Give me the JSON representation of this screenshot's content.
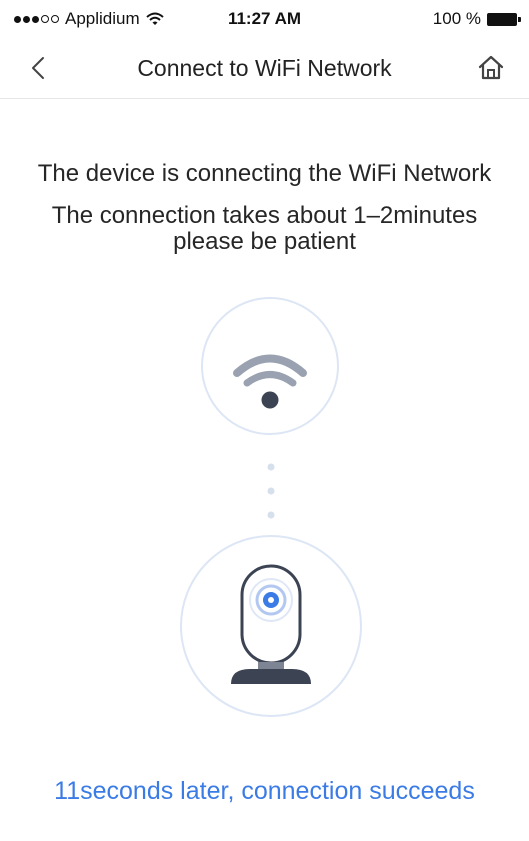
{
  "status_bar": {
    "carrier": "Applidium",
    "time": "11:27 AM",
    "battery": "100 %"
  },
  "nav": {
    "title": "Connect to WiFi Network",
    "back_icon": "chevron-left-icon",
    "home_icon": "home-icon"
  },
  "message": {
    "line1": "The device is connecting the WiFi Network",
    "line2": "The connection takes about 1–2minutes",
    "line3": "please be patient"
  },
  "illustration": {
    "top_icon": "wifi-icon",
    "bottom_icon": "camera-icon"
  },
  "footer": {
    "countdown": "11seconds later, connection succeeds"
  },
  "colors": {
    "accent": "#3b7be5",
    "device_dark": "#3c4352",
    "circle_border": "#dde6f5"
  }
}
